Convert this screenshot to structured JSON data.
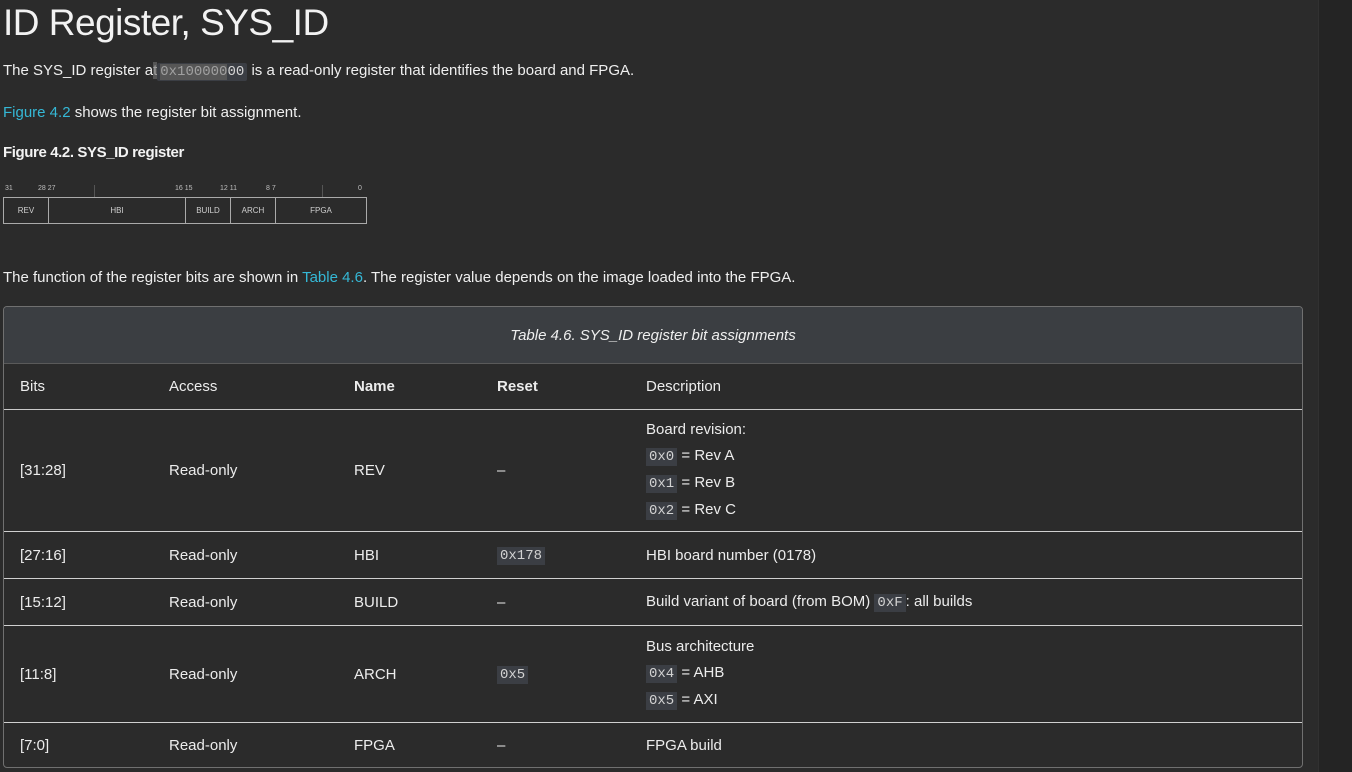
{
  "heading": "ID Register, SYS_ID",
  "intro": {
    "prefix": "The SYS_ID register a",
    "selected_char": "t",
    "address_selected": "0x100000",
    "address_rest": "00",
    "suffix": " is a read-only register that identifies the board and FPGA."
  },
  "figure_ref": {
    "link": "Figure 4.2",
    "text": " shows the register bit assignment."
  },
  "figure_title": "Figure 4.2. SYS_ID register",
  "register_fig": {
    "bit_labels": [
      "31",
      "28 27",
      "16 15",
      "12 11",
      "8 7",
      "0"
    ],
    "fields": [
      "REV",
      "HBI",
      "BUILD",
      "ARCH",
      "FPGA"
    ]
  },
  "function_text": {
    "prefix": "The function of the register bits are shown in ",
    "link": "Table 4.6",
    "suffix": ". The register value depends on the image loaded into the FPGA."
  },
  "table": {
    "caption": "Table 4.6. SYS_ID register bit assignments",
    "headers": [
      "Bits",
      "Access",
      "Name",
      "Reset",
      "Description"
    ],
    "rows": [
      {
        "bits": "[31:28]",
        "access": "Read-only",
        "name": "REV",
        "reset": "–",
        "desc_title": "Board revision:",
        "desc_items": [
          {
            "code": "0x0",
            "text": " = Rev A"
          },
          {
            "code": "0x1",
            "text": " = Rev B"
          },
          {
            "code": "0x2",
            "text": " = Rev C"
          }
        ]
      },
      {
        "bits": "[27:16]",
        "access": "Read-only",
        "name": "HBI",
        "reset_code": "0x178",
        "desc": "HBI board number (0178)"
      },
      {
        "bits": "[15:12]",
        "access": "Read-only",
        "name": "BUILD",
        "reset": "–",
        "desc": "Build variant of board (from BOM) ",
        "desc_code": "0xF",
        "desc_suffix": ": all builds"
      },
      {
        "bits": "[11:8]",
        "access": "Read-only",
        "name": "ARCH",
        "reset_code": "0x5",
        "desc_title": "Bus architecture",
        "desc_items": [
          {
            "code": "0x4",
            "text": " = AHB"
          },
          {
            "code": "0x5",
            "text": " = AXI"
          }
        ]
      },
      {
        "bits": "[7:0]",
        "access": "Read-only",
        "name": "FPGA",
        "reset": "–",
        "desc": "FPGA build"
      }
    ]
  }
}
